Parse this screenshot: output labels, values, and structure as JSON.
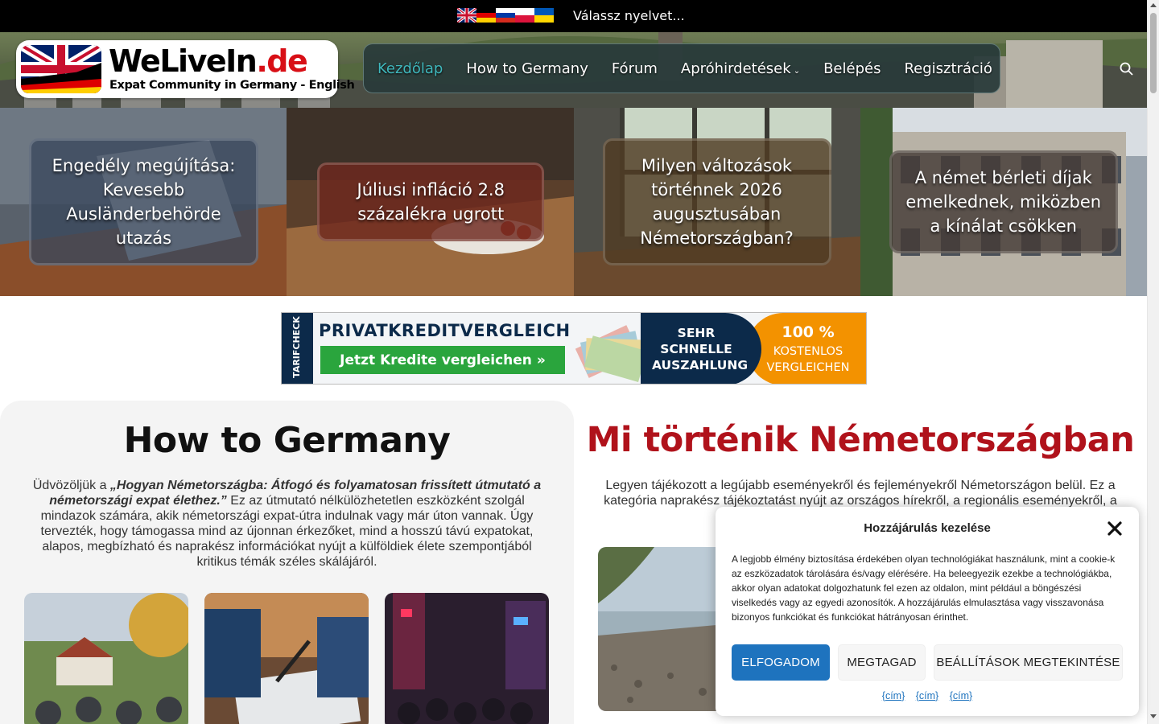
{
  "language_bar": {
    "flags": [
      "flag-uk-icon",
      "flag-germany-icon",
      "flag-russia-icon",
      "flag-poland-icon",
      "flag-ukraine-icon"
    ],
    "label": "Válassz nyelvet..."
  },
  "header": {
    "logo": {
      "title_main": "WeLiveIn",
      "title_suffix": ".de",
      "subtitle": "Expat Community in Germany - English"
    },
    "nav": [
      {
        "label": "Kezdőlap",
        "active": true
      },
      {
        "label": "How to Germany",
        "active": false
      },
      {
        "label": "Fórum",
        "active": false
      },
      {
        "label": "Apróhirdetések",
        "active": false,
        "dropdown": true
      },
      {
        "label": "Belépés",
        "active": false
      },
      {
        "label": "Regisztráció",
        "active": false
      }
    ],
    "search_icon": "search-icon"
  },
  "hero_tiles": [
    {
      "title": "Engedély megújítása: Kevesebb Ausländerbehörde utazás"
    },
    {
      "title": "Júliusi infláció 2.8 százalékra ugrott"
    },
    {
      "title": "Milyen változások történnek 2026 augusztusában Németországban?"
    },
    {
      "title": "A német bérleti díjak emelkednek, miközben a kínálat csökken"
    }
  ],
  "ad_banner": {
    "brand": "TARIFCHECK",
    "title": "PRIVATKREDITVERGLEICH",
    "button": "Jetzt Kredite vergleichen »",
    "payout_text": "SEHR SCHNELLE AUSZAHLUNG",
    "free_big": "100 %",
    "free_small": "KOSTENLOS VERGLEICHEN"
  },
  "how_to_germany": {
    "heading": "How to Germany",
    "intro_prefix": "Üdvözöljük a ",
    "intro_emphasis": "„Hogyan Németországba: Átfogó és folyamatosan frissített útmutató a németországi expat élethez.”",
    "intro_rest": " Ez az útmutató nélkülözhetetlen eszközként szolgál mindazok számára, akik németországi expat-útra indulnak vagy már úton vannak. Úgy tervezték, hogy támogassa mind az újonnan érkezőket, mind a hosszú távú expatokat, alapos, megbízható és naprakész információkat nyújt a külföldiek élete szempontjából kritikus témák széles skálájáról."
  },
  "news": {
    "heading": "Mi történik Németországban",
    "intro": "Legyen tájékozott a legújabb eseményekről és fejleményekről Németországon belül. Ez a kategória naprakész tájékoztatást nyújt az országos hírekről, a regionális eseményekről, a politikai változ"
  },
  "cookie_modal": {
    "title": "Hozzájárulás kezelése",
    "body": "A legjobb élmény biztosítása érdekében olyan technológiákat használunk, mint a cookie-k az eszközadatok tárolására és/vagy elérésére. Ha beleegyezik ezekbe a technológiákba, akkor olyan adatokat dolgozhatunk fel ezen az oldalon, mint például a böngészési viselkedés vagy az egyedi azonosítók. A hozzájárulás elmulasztása vagy visszavonása bizonyos funkciókat és funkciókat hátrányosan érinthet.",
    "accept": "ELFOGADOM",
    "deny": "MEGTAGAD",
    "preferences": "BEÁLLÍTÁSOK MEGTEKINTÉSE",
    "links": [
      "{cím}",
      "{cím}",
      "{cím}"
    ]
  }
}
